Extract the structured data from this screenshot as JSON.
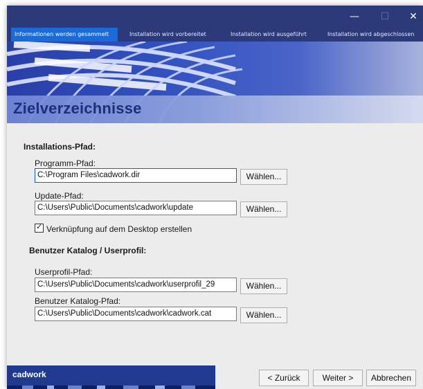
{
  "window": {
    "controls": {
      "minimize": "—",
      "maximize": "☐",
      "close": "✕"
    }
  },
  "steps": [
    {
      "label": "Informationen werden gesammelt",
      "active": true
    },
    {
      "label": "Installation wird vorbereitet",
      "active": false
    },
    {
      "label": "Installation wird ausgeführt",
      "active": false
    },
    {
      "label": "Installation wird abgeschlossen",
      "active": false
    }
  ],
  "page": {
    "title": "Zielverzeichnisse"
  },
  "installation": {
    "heading": "Installations-Pfad:",
    "program_label": "Programm-Pfad:",
    "program_value": "C:\\Program Files\\cadwork.dir",
    "update_label": "Update-Pfad:",
    "update_value": "C:\\Users\\Public\\Documents\\cadwork\\update",
    "browse_label": "Wählen...",
    "shortcut_label": "Verknüpfung auf dem Desktop erstellen",
    "shortcut_checked": true
  },
  "catalog": {
    "heading": "Benutzer Katalog / Userprofil:",
    "userprofile_label": "Userprofil-Pfad:",
    "userprofile_value": "C:\\Users\\Public\\Documents\\cadwork\\userprofil_29",
    "catalog_label": "Benutzer Katalog-Pfad:",
    "catalog_value": "C:\\Users\\Public\\Documents\\cadwork\\cadwork.cat",
    "browse_label": "Wählen..."
  },
  "footer": {
    "brand": "cadwork",
    "back_label": "< Zurück",
    "next_label": "Weiter >",
    "cancel_label": "Abbrechen"
  },
  "colors": {
    "header_bg": "#2c3a7a",
    "active_step": "#1a6bd8",
    "title": "#1c2f7a",
    "brand_bg": "#1f3a8e"
  }
}
